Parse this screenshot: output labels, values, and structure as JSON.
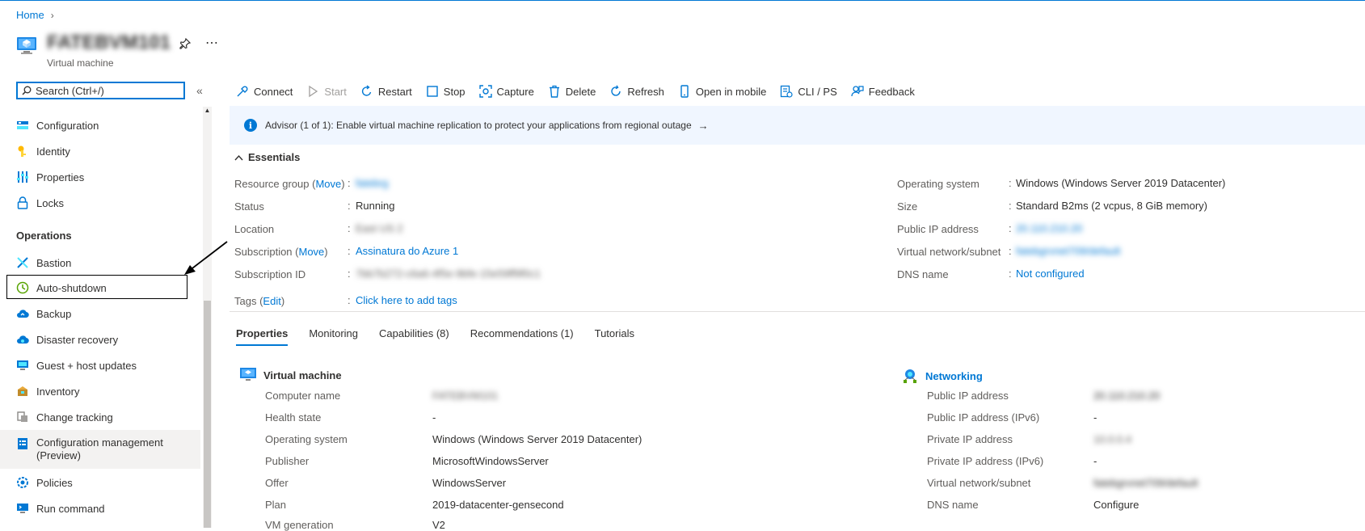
{
  "breadcrumb": {
    "home": "Home"
  },
  "vm": {
    "name": "FATEBVM101",
    "type": "Virtual machine"
  },
  "search": {
    "placeholder": "Search (Ctrl+/)"
  },
  "sidebar": {
    "items": [
      {
        "label": "Configuration",
        "icon": "configuration-icon"
      },
      {
        "label": "Identity",
        "icon": "identity-icon"
      },
      {
        "label": "Properties",
        "icon": "properties-icon"
      },
      {
        "label": "Locks",
        "icon": "lock-icon"
      }
    ],
    "operations_header": "Operations",
    "operations": [
      {
        "label": "Bastion",
        "icon": "bastion-icon"
      },
      {
        "label": "Auto-shutdown",
        "icon": "clock-icon"
      },
      {
        "label": "Backup",
        "icon": "cloud-icon"
      },
      {
        "label": "Disaster recovery",
        "icon": "cloud-icon"
      },
      {
        "label": "Guest + host updates",
        "icon": "monitor-icon"
      },
      {
        "label": "Inventory",
        "icon": "inventory-icon"
      },
      {
        "label": "Change tracking",
        "icon": "change-tracking-icon"
      },
      {
        "label": "Configuration management\n(Preview)",
        "icon": "config-management-icon"
      },
      {
        "label": "Policies",
        "icon": "policies-icon"
      },
      {
        "label": "Run command",
        "icon": "run-command-icon"
      }
    ]
  },
  "toolbar": {
    "connect": "Connect",
    "start": "Start",
    "restart": "Restart",
    "stop": "Stop",
    "capture": "Capture",
    "delete": "Delete",
    "refresh": "Refresh",
    "open_mobile": "Open in mobile",
    "cli": "CLI / PS",
    "feedback": "Feedback"
  },
  "advisor": {
    "message": "Advisor (1 of 1): Enable virtual machine replication to protect your applications from regional outage",
    "arrow": "→"
  },
  "essentials": {
    "title": "Essentials",
    "left": {
      "resource_group_label": "Resource group",
      "move": "Move",
      "resource_group_value": "fatebrg",
      "status_label": "Status",
      "status_value": "Running",
      "location_label": "Location",
      "location_value": "East US 2",
      "subscription_label": "Subscription",
      "subscription_value": "Assinatura do Azure 1",
      "subscription_id_label": "Subscription ID",
      "subscription_id_value": "7bb7b272-c6a6-4f5e-9bfe-15e59ff9f0c1",
      "tags_label": "Tags",
      "edit": "Edit",
      "tags_value": "Click here to add tags"
    },
    "right": {
      "os_label": "Operating system",
      "os_value": "Windows (Windows Server 2019 Datacenter)",
      "size_label": "Size",
      "size_value": "Standard B2ms (2 vcpus, 8 GiB memory)",
      "public_ip_label": "Public IP address",
      "public_ip_value": "20.110.210.20",
      "vnet_label": "Virtual network/subnet",
      "vnet_value": "fatebgrvnet709/default",
      "dns_label": "DNS name",
      "dns_value": "Not configured"
    }
  },
  "tabs": [
    "Properties",
    "Monitoring",
    "Capabilities (8)",
    "Recommendations (1)",
    "Tutorials"
  ],
  "vm_props": {
    "title": "Virtual machine",
    "rows": [
      {
        "label": "Computer name",
        "value": "FATEBVM101"
      },
      {
        "label": "Health state",
        "value": "-"
      },
      {
        "label": "Operating system",
        "value": "Windows (Windows Server 2019 Datacenter)"
      },
      {
        "label": "Publisher",
        "value": "MicrosoftWindowsServer"
      },
      {
        "label": "Offer",
        "value": "WindowsServer"
      },
      {
        "label": "Plan",
        "value": "2019-datacenter-gensecond"
      },
      {
        "label": "VM generation",
        "value": "V2"
      }
    ]
  },
  "networking": {
    "title": "Networking",
    "rows": [
      {
        "label": "Public IP address",
        "value": "20.110.210.20"
      },
      {
        "label": "Public IP address (IPv6)",
        "value": "-"
      },
      {
        "label": "Private IP address",
        "value": "10.0.0.4"
      },
      {
        "label": "Private IP address (IPv6)",
        "value": "-"
      },
      {
        "label": "Virtual network/subnet",
        "value": "fatebgrvnet709/default"
      },
      {
        "label": "DNS name",
        "value": "Configure"
      }
    ]
  },
  "colors": {
    "accent": "#0078d4",
    "banner_bg": "#f0f6ff"
  }
}
